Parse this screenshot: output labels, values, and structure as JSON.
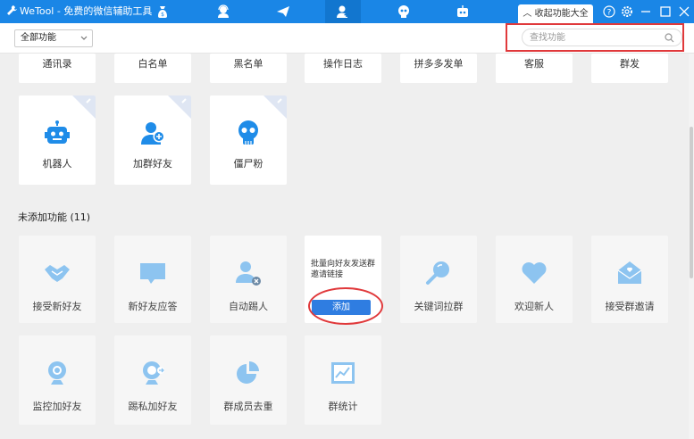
{
  "titlebar": {
    "title": "WeTool - 免费的微信辅助工具",
    "fav_tab": "收起功能大全",
    "nav_icons": [
      "money-bag-icon",
      "user-support-icon",
      "send-icon",
      "add-user-icon",
      "skull-icon",
      "robot-icon"
    ],
    "colors": {
      "bar": "#1a86e6"
    }
  },
  "toolbar": {
    "filter_value": "全部功能",
    "search_placeholder": "查找功能"
  },
  "added": {
    "top_row": [
      "通讯录",
      "白名单",
      "黑名单",
      "操作日志",
      "拼多多发单",
      "客服",
      "群发"
    ],
    "second_row": [
      {
        "label": "机器人",
        "icon": "robot-icon"
      },
      {
        "label": "加群好友",
        "icon": "add-group-friend-icon"
      },
      {
        "label": "僵尸粉",
        "icon": "skull-icon"
      }
    ]
  },
  "not_added": {
    "title": "未添加功能 (11)",
    "row1": [
      {
        "label": "接受新好友",
        "icon": "handshake-icon"
      },
      {
        "label": "新好友应答",
        "icon": "chat-bubble-icon"
      },
      {
        "label": "自动踢人",
        "icon": "remove-user-icon"
      },
      {
        "tip": "批量向好友发送群邀请链接",
        "button": "添加"
      },
      {
        "label": "关键词拉群",
        "icon": "magnifier-icon"
      },
      {
        "label": "欢迎新人",
        "icon": "heart-icon"
      },
      {
        "label": "接受群邀请",
        "icon": "invite-mail-icon"
      }
    ],
    "row2": [
      {
        "label": "监控加好友",
        "icon": "webcam-icon"
      },
      {
        "label": "踢私加好友",
        "icon": "kick-webcam-icon"
      },
      {
        "label": "群成员去重",
        "icon": "pie-chart-icon"
      },
      {
        "label": "群统计",
        "icon": "line-chart-icon"
      }
    ]
  },
  "colors": {
    "accent": "#2f7de1",
    "highlight": "#e0393b",
    "icon_added": "#1f8ce8",
    "icon_inactive": "#8dc4f0"
  }
}
